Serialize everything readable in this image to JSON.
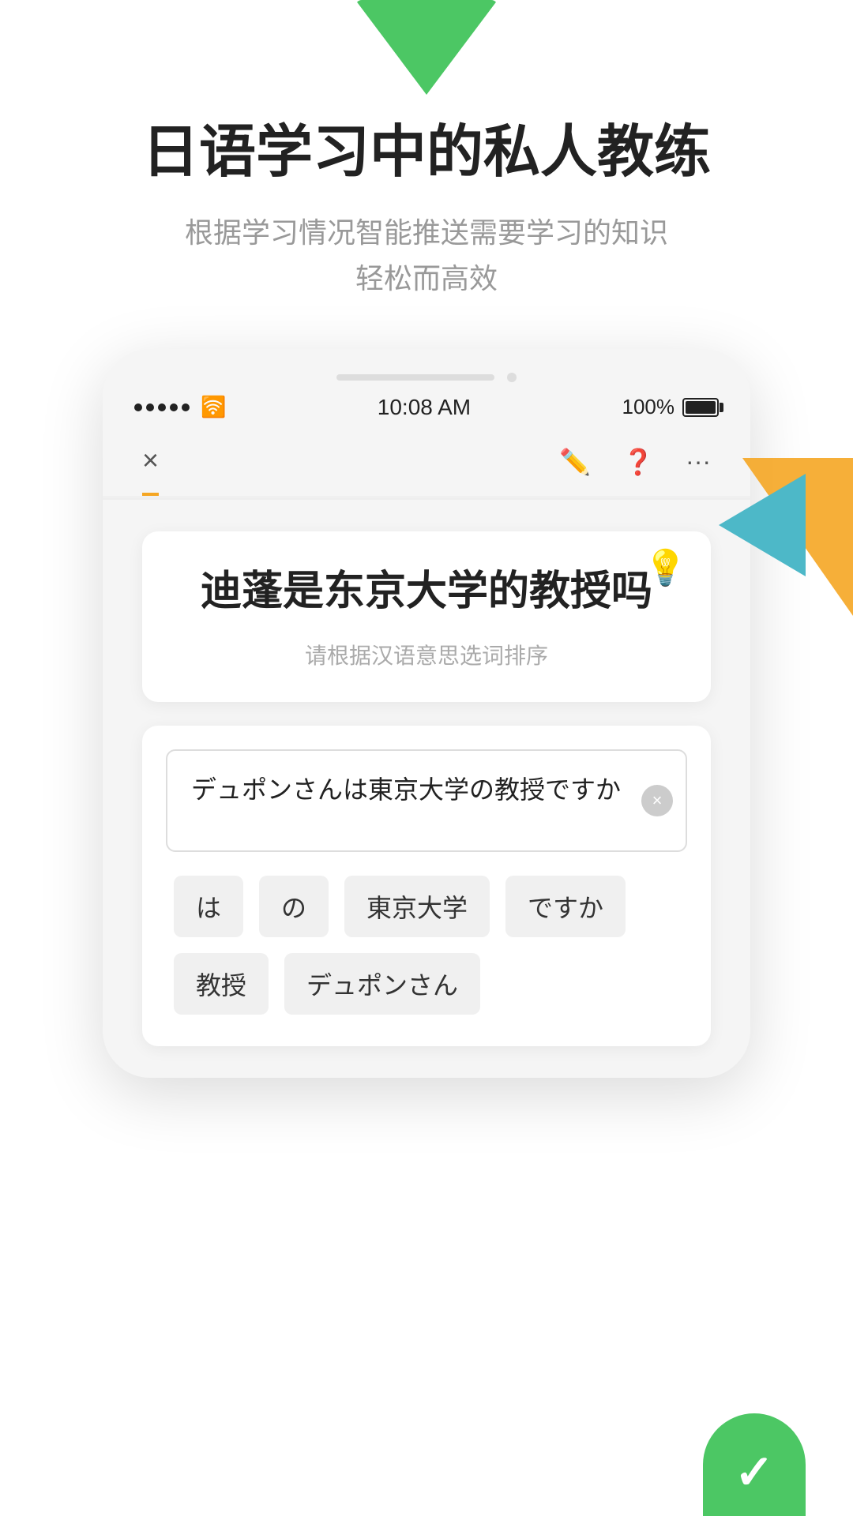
{
  "page": {
    "background": "#ffffff"
  },
  "decorations": {
    "top_triangle_color": "#4cc764",
    "right_teal_color": "#4db8c8",
    "right_orange_color": "#f5a623",
    "bottom_check_color": "#4cc764"
  },
  "header": {
    "headline": "日语学习中的私人教练",
    "subtitle_line1": "根据学习情况智能推送需要学习的知识",
    "subtitle_line2": "轻松而高效"
  },
  "phone": {
    "status_bar": {
      "time": "10:08 AM",
      "battery": "100%",
      "signal": "●●●●●",
      "wifi": "WiFi"
    },
    "nav": {
      "close_label": "×",
      "icons": [
        "edit",
        "help",
        "more"
      ]
    },
    "question_card": {
      "bulb_emoji": "💡",
      "question_text": "迪蓬是东京大学的教授吗",
      "hint_text": "请根据汉语意思选词排序"
    },
    "answer_area": {
      "current_answer": "デュポンさんは東京大学の教授ですか",
      "clear_button": "×",
      "word_chips": [
        "は",
        "の",
        "東京大学",
        "ですか",
        "教授",
        "デュポンさん"
      ]
    }
  }
}
